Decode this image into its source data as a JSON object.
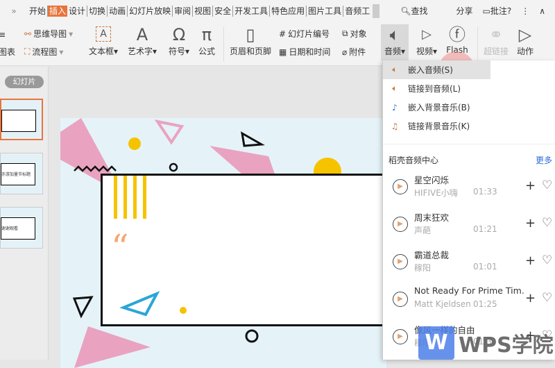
{
  "tabs": {
    "overflow": "»",
    "items": [
      "开始",
      "插入",
      "设计",
      "切换",
      "动画",
      "幻灯片放映",
      "审阅",
      "视图",
      "安全",
      "开发工具",
      "特色应用",
      "图片工具",
      "音频工"
    ],
    "active": 1,
    "search": "查找",
    "share": "分享",
    "comment": "批注",
    "help": "?",
    "more": "⋮",
    "collapse": "∧"
  },
  "ribbon": {
    "chart": "图表",
    "mindmap": "思维导图",
    "flow": "流程图",
    "textbox": "文本框",
    "wordart": "艺术字",
    "symbol": "符号",
    "formula": "公式",
    "header_footer": "页眉和页脚",
    "slide_number": "幻灯片编号",
    "object": "对象",
    "datetime": "日期和时间",
    "attachment": "附件",
    "audio": "音频",
    "video": "视频",
    "flash": "Flash",
    "hyperlink": "超链接",
    "action": "动作"
  },
  "left": {
    "label": "幻灯片",
    "thumbs": [
      "",
      "亦游加量节标题",
      "谢谢观看"
    ]
  },
  "menu": {
    "items": [
      "嵌入音频(S)",
      "链接到音频(L)",
      "嵌入背景音乐(B)",
      "链接背景音乐(K)"
    ],
    "section": "稻壳音频中心",
    "more": "更多",
    "songs": [
      {
        "title": "星空闪烁",
        "artist": "HIFIVE小嗨",
        "duration": "01:33"
      },
      {
        "title": "周末狂欢",
        "artist": "声葩",
        "duration": "01:21"
      },
      {
        "title": "霸道总裁",
        "artist": "稼阳",
        "duration": "01:01"
      },
      {
        "title": "Not Ready For Prime Tim.",
        "artist": "Matt Kjeldsen",
        "duration": "01:25"
      },
      {
        "title": "像风一样的自由",
        "artist": "稼阳",
        "duration": "01:3"
      }
    ]
  },
  "watermark": "WPS学院",
  "colors": {
    "accent": "#e8743b",
    "link": "#2e6bd6",
    "pink": "#e9a3c0",
    "yellow": "#f6c300"
  }
}
